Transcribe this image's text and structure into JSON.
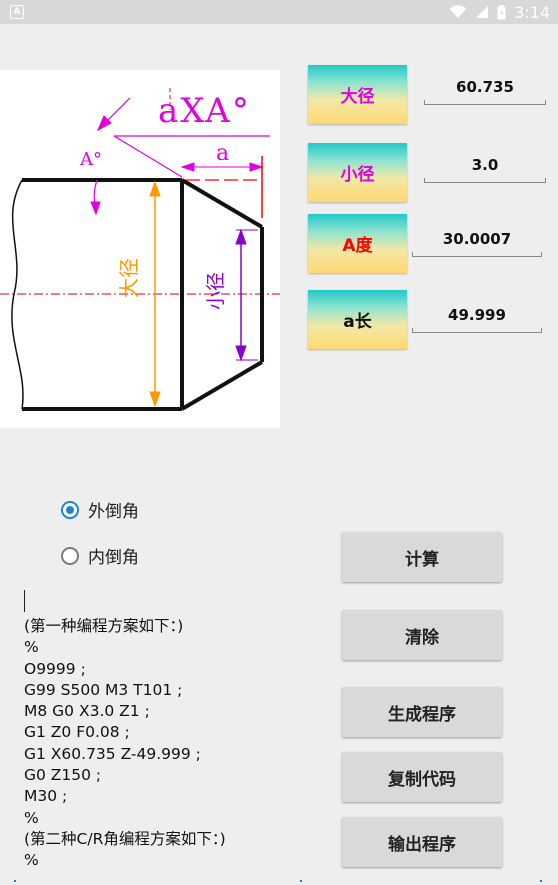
{
  "status_bar": {
    "time": "3:14",
    "app_icon": "A"
  },
  "diagram": {
    "chamfer_label": "aXA°",
    "angle_label": "A°",
    "length_label": "a",
    "major_dia_label": "大径",
    "minor_dia_label": "小径"
  },
  "params": [
    {
      "label": "大径",
      "value": "60.735",
      "label_color": "#e000e0"
    },
    {
      "label": "小径",
      "value": "3.0",
      "label_color": "#e000e0"
    },
    {
      "label": "A度",
      "value": "30.0007",
      "label_color": "#ff0000"
    },
    {
      "label": "a长",
      "value": "49.999",
      "label_color": "#111111"
    }
  ],
  "chamfer_type": {
    "options": [
      {
        "label": "外倒角",
        "checked": true
      },
      {
        "label": "内倒角",
        "checked": false
      }
    ]
  },
  "buttons": {
    "calculate": "计算",
    "clear": "清除",
    "generate": "生成程序",
    "copy": "复制代码",
    "output": "输出程序"
  },
  "code_lines": [
    "(第一种编程方案如下：)",
    "%",
    "O9999 ;",
    "G99 S500 M3 T101 ;",
    "M8 G0 X3.0 Z1 ;",
    "G1 Z0 F0.08 ;",
    "G1 X60.735 Z-49.999 ;",
    "G0 Z150 ;",
    "M30 ;",
    "%",
    "(第二种C/R角编程方案如下：)",
    "%"
  ],
  "colors": {
    "accent": "#1a85c8",
    "orange": "#ff9900",
    "purple": "#8800cc",
    "magenta": "#e000e0",
    "red": "#ff0000"
  }
}
